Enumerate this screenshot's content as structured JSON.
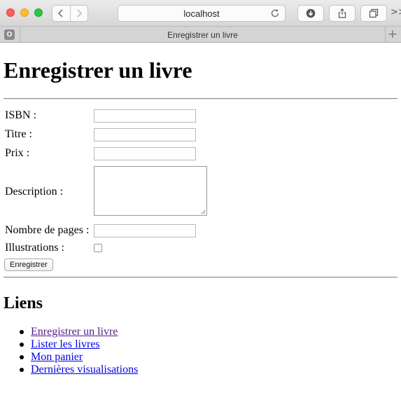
{
  "browser": {
    "address": "localhost",
    "tab_title": "Enregistrer un livre",
    "tab_favicon_letter": "O",
    "icons": [
      "back-icon",
      "forward-icon",
      "reload-icon",
      "download-icon",
      "share-icon",
      "tabs-icon",
      "new-tab-icon"
    ],
    "overflow_symbol": ">>",
    "new_tab_symbol": "+"
  },
  "page": {
    "title": "Enregistrer un livre",
    "form": {
      "isbn_label": "ISBN :",
      "isbn_value": "",
      "titre_label": "Titre :",
      "titre_value": "",
      "prix_label": "Prix :",
      "prix_value": "",
      "description_label": "Description :",
      "description_value": "",
      "pages_label": "Nombre de pages :",
      "pages_value": "",
      "illustrations_label": "Illustrations :",
      "illustrations_checked": false,
      "submit_label": "Enregistrer"
    },
    "links_title": "Liens",
    "links": [
      {
        "label": "Enregistrer un livre",
        "visited": true
      },
      {
        "label": "Lister les livres",
        "visited": false
      },
      {
        "label": "Mon panier",
        "visited": false
      },
      {
        "label": "Dernières visualisations",
        "visited": false
      }
    ]
  }
}
